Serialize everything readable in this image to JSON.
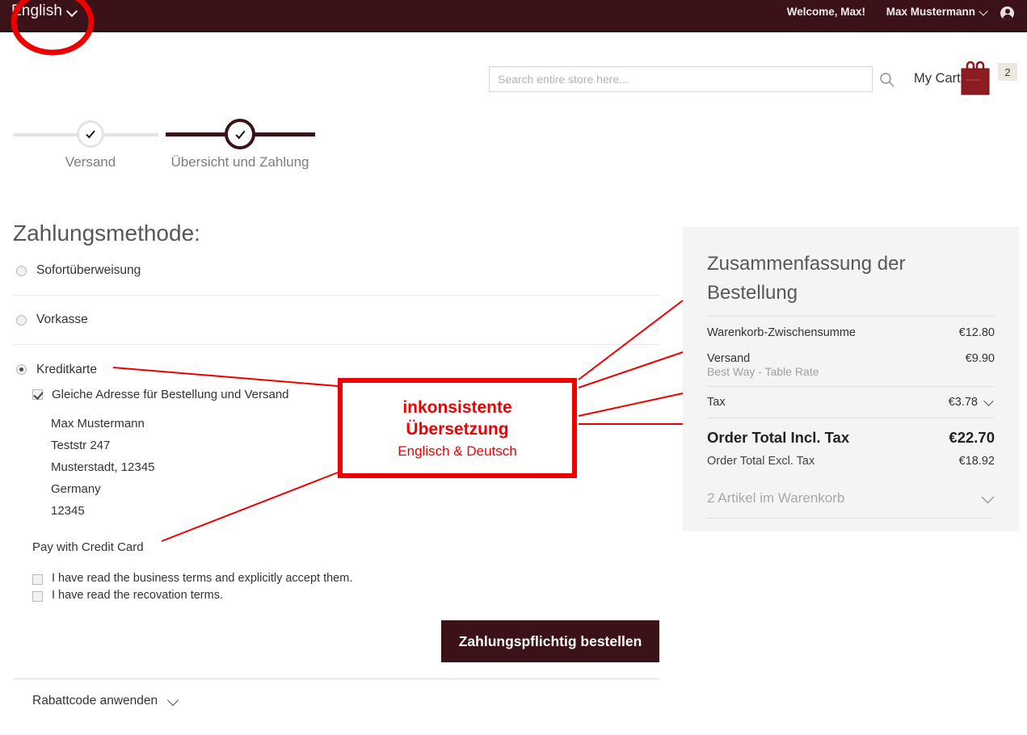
{
  "header": {
    "language_label": "English",
    "language_icon": "chevron-down-icon",
    "welcome_text": "Welcome, Max!",
    "account_name": "Max Mustermann",
    "account_icon": "chevron-down-icon",
    "avatar_icon": "user-avatar-icon",
    "bar_color": "#3a1217"
  },
  "search": {
    "placeholder": "Search entire store here...",
    "value": "",
    "icon": "search-icon"
  },
  "cart": {
    "label": "My Cart",
    "icon": "shopping-bag-icon",
    "count": "2"
  },
  "progress": {
    "steps": [
      {
        "label": "Versand",
        "state": "done",
        "icon": "check-icon"
      },
      {
        "label": "Übersicht und Zahlung",
        "state": "current",
        "icon": "check-icon"
      }
    ]
  },
  "payment": {
    "title": "Zahlungsmethode:",
    "methods": [
      {
        "label": "Sofortüberweisung",
        "selected": false
      },
      {
        "label": "Vorkasse",
        "selected": false
      },
      {
        "label": "Kreditkarte",
        "selected": true
      }
    ],
    "same_address_label": "Gleiche Adresse für Bestellung und Versand",
    "same_address_checked": true,
    "address": [
      "Max Mustermann",
      "Teststr 247",
      "Musterstadt, 12345",
      "Germany",
      "12345"
    ],
    "pay_with_label": "Pay with Credit Card",
    "terms": [
      {
        "label": "I have read the business terms and explicitly accept them.",
        "checked": false
      },
      {
        "label": "I have read the recovation terms.",
        "checked": false
      }
    ],
    "order_button": "Zahlungspflichtig bestellen",
    "discount_label": "Rabattcode anwenden",
    "discount_icon": "chevron-down-icon"
  },
  "summary": {
    "title": "Zusammenfassung der Bestellung",
    "rows": [
      {
        "label": "Warenkorb-Zwischensumme",
        "value": "€12.80"
      },
      {
        "label": "Versand",
        "value": "€9.90",
        "sublabel": "Best Way - Table Rate"
      },
      {
        "label": "Tax",
        "value": "€3.78",
        "icon": "chevron-down-icon"
      },
      {
        "label": "Order Total Incl. Tax",
        "value": "€22.70"
      },
      {
        "label": "Order Total Excl. Tax",
        "value": "€18.92"
      }
    ],
    "items_label": "2 Artikel im Warenkorb",
    "items_icon": "chevron-down-icon"
  },
  "annotation": {
    "line1": "inkonsistente",
    "line2": "Übersetzung",
    "line3": "Englisch & Deutsch",
    "color": "#ee0000",
    "circle_icon": "highlight-circle-icon"
  }
}
